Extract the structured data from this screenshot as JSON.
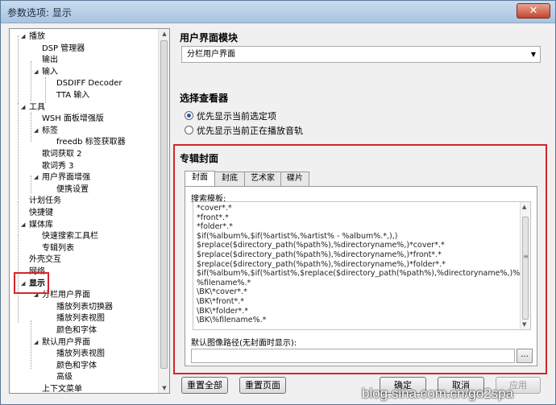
{
  "window": {
    "title": "参数选项: 显示",
    "close": "✕"
  },
  "tree": {
    "items": [
      {
        "label": "播放",
        "arrow": "◢"
      },
      {
        "label": "DSP 管理器",
        "arrow": ""
      },
      {
        "label": "输出",
        "arrow": ""
      },
      {
        "label": "输入",
        "arrow": "◢"
      },
      {
        "label": "DSDIFF Decoder",
        "arrow": ""
      },
      {
        "label": "TTA 输入",
        "arrow": ""
      },
      {
        "label": "工具",
        "arrow": "◢"
      },
      {
        "label": "WSH 面板增强版",
        "arrow": ""
      },
      {
        "label": "标签",
        "arrow": "◢"
      },
      {
        "label": "freedb 标签获取器",
        "arrow": ""
      },
      {
        "label": "歌词获取 2",
        "arrow": ""
      },
      {
        "label": "歌词秀 3",
        "arrow": ""
      },
      {
        "label": "用户界面增强",
        "arrow": "◢"
      },
      {
        "label": "便携设置",
        "arrow": ""
      },
      {
        "label": "计划任务",
        "arrow": ""
      },
      {
        "label": "快捷键",
        "arrow": ""
      },
      {
        "label": "媒体库",
        "arrow": "◢"
      },
      {
        "label": "快速搜索工具栏",
        "arrow": ""
      },
      {
        "label": "专辑列表",
        "arrow": ""
      },
      {
        "label": "外壳交互",
        "arrow": ""
      },
      {
        "label": "网络",
        "arrow": ""
      },
      {
        "label": "显示",
        "arrow": "◢"
      },
      {
        "label": "分栏用户界面",
        "arrow": "◢"
      },
      {
        "label": "播放列表切换器",
        "arrow": ""
      },
      {
        "label": "播放列表视图",
        "arrow": ""
      },
      {
        "label": "颜色和字体",
        "arrow": ""
      },
      {
        "label": "默认用户界面",
        "arrow": "◢"
      },
      {
        "label": "播放列表视图",
        "arrow": ""
      },
      {
        "label": "颜色和字体",
        "arrow": ""
      },
      {
        "label": "高级",
        "arrow": ""
      },
      {
        "label": "上下文菜单",
        "arrow": ""
      }
    ],
    "scroll_up": "▲",
    "scroll_down": "▼"
  },
  "ui_module": {
    "title": "用户界面模块",
    "selected": "分栏用户界面",
    "caret": "▼"
  },
  "viewer": {
    "title": "选择查看器",
    "options": [
      {
        "label": "优先显示当前选定项",
        "checked": true
      },
      {
        "label": "优先显示当前正在播放音轨",
        "checked": false
      }
    ]
  },
  "album_art": {
    "title": "专辑封面",
    "tabs": [
      "封面",
      "封底",
      "艺术家",
      "碟片"
    ],
    "search_label": "搜索模板:",
    "search_lines": [
      "*cover*.*",
      "*front*.*",
      "*folder*.*",
      "$if(%album%,$if(%artist%,%artist% - %album%.*,),)",
      "$replace($directory_path(%path%),%directoryname%,)*cover*.*",
      "$replace($directory_path(%path%),%directoryname%,)*front*.*",
      "$replace($directory_path(%path%),%directoryname%,)*folder*.*",
      "$if(%album%,$if(%artist%,$replace($directory_path(%path%),%directoryname%,)%art",
      "%filename%.*",
      "\\BK\\*cover*.*",
      "\\BK\\*front*.*",
      "\\BK\\*folder*.*",
      "\\BK\\%filename%.*"
    ],
    "scroll_up": "▲",
    "scroll_down": "▼",
    "scroll_grip": "≡",
    "default_label": "默认图像路径(无封面时显示):",
    "default_value": "",
    "browse": "..."
  },
  "buttons": {
    "reset_all": "重置全部",
    "reset_page": "重置页面",
    "ok": "确定",
    "cancel": "取消",
    "apply": "应用"
  },
  "watermark": "blog.sina.com.cn/go2spa",
  "colors": {
    "highlight_red": "#d3262a",
    "title_bar": "#b9d1ea"
  }
}
